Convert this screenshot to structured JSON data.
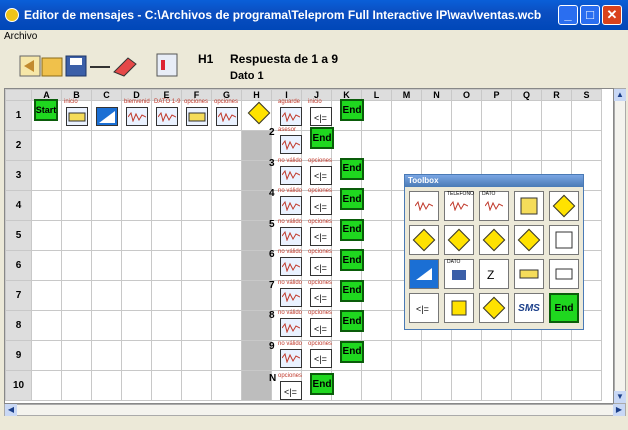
{
  "window": {
    "title": "Editor de mensajes - C:\\Archivos de programa\\Teleprom Full Interactive IP\\wav\\ventas.wcb"
  },
  "menu": {
    "archivo": "Archivo"
  },
  "toolbar": {
    "h1": "H1",
    "respuesta": "Respuesta de 1 a 9",
    "dato": "Dato 1"
  },
  "grid": {
    "columns": [
      "A",
      "B",
      "C",
      "D",
      "E",
      "F",
      "G",
      "H",
      "I",
      "J",
      "K",
      "L",
      "M",
      "N",
      "O",
      "P",
      "Q",
      "R",
      "S"
    ],
    "rows": [
      "1",
      "2",
      "3",
      "4",
      "5",
      "6",
      "7",
      "8",
      "9",
      "10"
    ],
    "start_label": "Start",
    "end_label": "End",
    "row1_labels": {
      "b": "inicio",
      "d": "bienvenid",
      "e": "DATO 1-9",
      "f": "opciones",
      "g": "opciones",
      "i": "aguarde",
      "j": "inicio"
    },
    "row2_label": "asesor",
    "branch_label_a": "no válido",
    "branch_label_b": "opciones",
    "branches": [
      "2",
      "3",
      "4",
      "5",
      "6",
      "7",
      "8",
      "9",
      "N"
    ],
    "n_label": "opciones"
  },
  "toolbox": {
    "title": "Toolbox",
    "telefono": "TELEFONO",
    "dato": "DATO",
    "dato2": "DATO",
    "sms": "SMS",
    "end": "End"
  }
}
